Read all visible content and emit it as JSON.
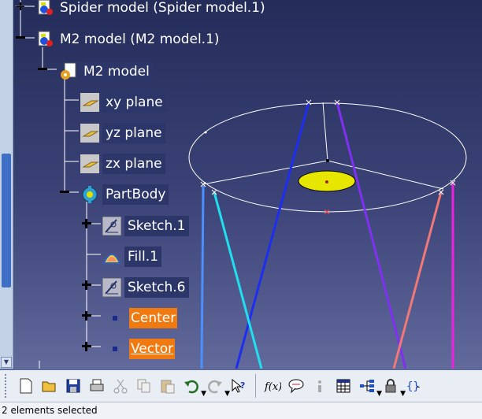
{
  "tree": {
    "spider_model": "Spider model (Spider model.1)",
    "m2_model_product": "M2 model (M2 model.1)",
    "m2_model_part": "M2 model",
    "xy_plane": "xy plane",
    "yz_plane": "yz plane",
    "zx_plane": "zx plane",
    "partbody": "PartBody",
    "sketch1": "Sketch.1",
    "fill1": "Fill.1",
    "sketch6": "Sketch.6",
    "center": "Center",
    "vector": "Vector"
  },
  "icons": {
    "product": "product-icon",
    "part": "part-icon",
    "plane": "plane-icon",
    "body": "gear-body-icon",
    "sketch": "sketch-icon",
    "fill": "fill-surface-icon",
    "point": "point-icon"
  },
  "toolbar": {
    "buttons": [
      "new-icon",
      "open-icon",
      "save-icon",
      "print-icon",
      "cut-icon",
      "copy-icon",
      "paste-icon",
      "undo-icon",
      "redo-icon",
      "whats-this-icon",
      "formula-icon",
      "comment-icon",
      "info-icon",
      "table-icon",
      "tree-icon",
      "lock-icon",
      "brackets-icon"
    ]
  },
  "status": {
    "message": "2 elements selected"
  },
  "colors": {
    "background_top": "#242c5a",
    "background_bottom": "#626a9c",
    "highlight_orange": "#f07a10",
    "scroll_thumb": "#3f6fc5"
  }
}
